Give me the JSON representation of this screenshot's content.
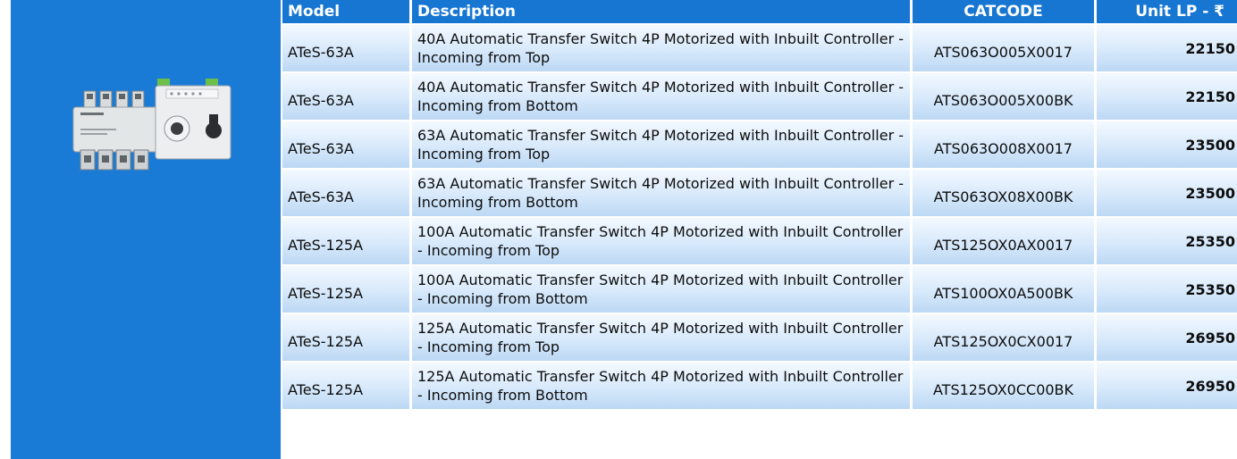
{
  "product_image": {
    "label": "ATS product photo"
  },
  "table": {
    "headers": {
      "model": "Model",
      "description": "Description",
      "catcode": "CATCODE",
      "unit_lp": "Unit LP - ₹"
    },
    "rows": [
      {
        "model": "ATeS-63A",
        "description": "40A Automatic Transfer Switch 4P Motorized with Inbuilt Controller - Incoming from Top",
        "catcode": "ATS063O005X0017",
        "unit_lp": "22150"
      },
      {
        "model": "ATeS-63A",
        "description": "40A Automatic Transfer Switch 4P Motorized with Inbuilt Controller - Incoming from Bottom",
        "catcode": "ATS063O005X00BK",
        "unit_lp": "22150"
      },
      {
        "model": "ATeS-63A",
        "description": "63A Automatic Transfer Switch 4P Motorized with Inbuilt Controller - Incoming from Top",
        "catcode": "ATS063O008X0017",
        "unit_lp": "23500"
      },
      {
        "model": "ATeS-63A",
        "description": "63A Automatic Transfer Switch 4P Motorized with Inbuilt Controller - Incoming from Bottom",
        "catcode": "ATS063OX08X00BK",
        "unit_lp": "23500"
      },
      {
        "model": "ATeS-125A",
        "description": "100A Automatic Transfer Switch 4P Motorized with Inbuilt Controller - Incoming from Top",
        "catcode": "ATS125OX0AX0017",
        "unit_lp": "25350"
      },
      {
        "model": "ATeS-125A",
        "description": "100A Automatic Transfer Switch 4P Motorized with Inbuilt Controller - Incoming from Bottom",
        "catcode": "ATS100OX0A500BK",
        "unit_lp": "25350"
      },
      {
        "model": "ATeS-125A",
        "description": "125A Automatic Transfer Switch 4P Motorized with Inbuilt Controller - Incoming from Top",
        "catcode": "ATS125OX0CX0017",
        "unit_lp": "26950"
      },
      {
        "model": "ATeS-125A",
        "description": "125A Automatic Transfer Switch 4P Motorized with Inbuilt Controller - Incoming from Bottom",
        "catcode": "ATS125OX0CC00BK",
        "unit_lp": "26950"
      }
    ]
  }
}
